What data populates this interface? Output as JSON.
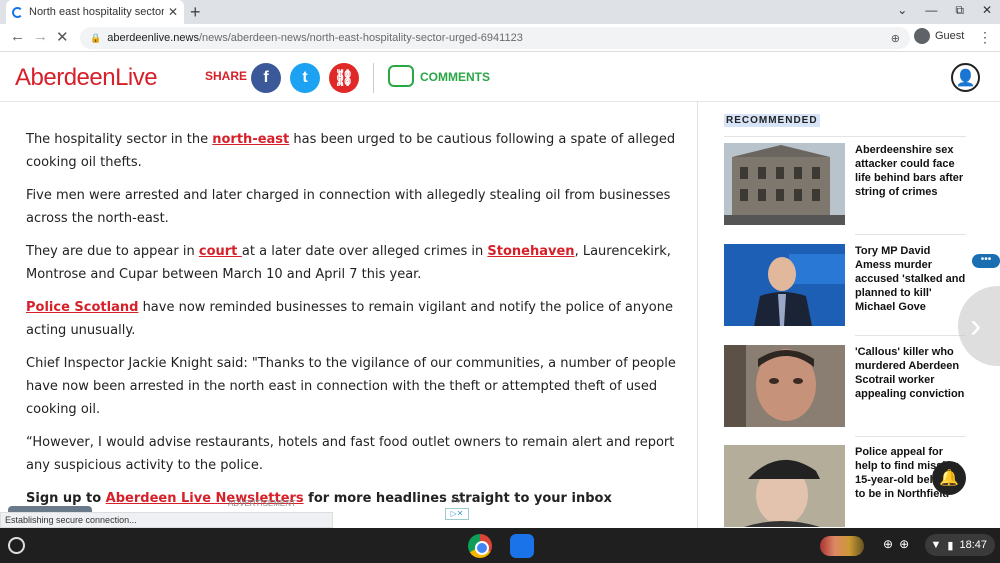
{
  "browser": {
    "tab_title": "North east hospitality sector urg",
    "new_tab": "+",
    "address_domain": "aberdeenlive.news",
    "address_path": "/news/aberdeen-news/north-east-hospitality-sector-urged-6941123",
    "profile_label": "Guest",
    "status_text": "Establishing secure connection..."
  },
  "site": {
    "logo": "AberdeenLive",
    "share_label": "SHARE",
    "facebook_glyph": "f",
    "twitter_glyph": "t",
    "link_glyph": "⛓",
    "comments_label": "COMMENTS"
  },
  "article": {
    "p1_before": "The hospitality sector in the ",
    "p1_link": "north-east",
    "p1_after": " has been urged to be cautious following a spate of alleged cooking oil thefts.",
    "p2": "Five men were arrested and later charged in connection with allegedly stealing oil from businesses across the north-east.",
    "p3_before": "They are due to appear in ",
    "p3_link1": "court ",
    "p3_mid": "at a later date over alleged crimes in ",
    "p3_link2": "Stonehaven",
    "p3_after": ", Laurencekirk, Montrose and Cupar between March 10 and April 7 this year.",
    "p4_link": "Police Scotland",
    "p4_after": " have now reminded businesses to remain vigilant and notify the police of anyone acting unusually.",
    "p5": "Chief Inspector Jackie Knight said: \"Thanks to the vigilance of our communities, a number of people have now been arrested in the north east in connection with the theft or attempted theft of used cooking oil.",
    "p6": "“However, I would advise restaurants, hotels and fast food outlet owners to remain alert and report any suspicious activity to the police.",
    "signup_before": "Sign up to ",
    "signup_link": "Aberdeen Live Newsletters",
    "signup_after": " for more headlines straight to your inbox",
    "ad_label": "ADVERTISEMENT"
  },
  "sidebar": {
    "title": "RECOMMENDED",
    "items": [
      {
        "headline": "Aberdeenshire sex attacker could face life behind bars after string of crimes"
      },
      {
        "headline": "Tory MP David Amess murder accused 'stalked and planned to kill' Michael Gove"
      },
      {
        "headline": "'Callous' killer who murdered Aberdeen Scotrail worker appealing conviction"
      },
      {
        "headline": "Police appeal for help to find missing 15-year-old believed to be in Northfield"
      }
    ]
  },
  "system": {
    "clock": "18:47"
  },
  "colors": {
    "brand_red": "#d6202a",
    "comments_green": "#29a745",
    "facebook_blue": "#3b5998",
    "twitter_blue": "#1da1f2"
  }
}
